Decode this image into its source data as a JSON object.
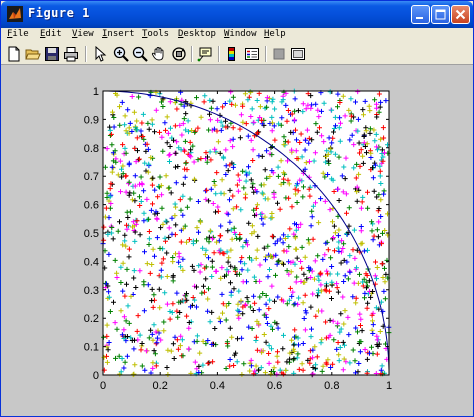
{
  "window": {
    "title": "Figure 1",
    "controls": [
      "minimize",
      "maximize",
      "close"
    ]
  },
  "menu": {
    "items": [
      {
        "label": "File",
        "key": "F"
      },
      {
        "label": "Edit",
        "key": "E"
      },
      {
        "label": "View",
        "key": "V"
      },
      {
        "label": "Insert",
        "key": "I"
      },
      {
        "label": "Tools",
        "key": "T"
      },
      {
        "label": "Desktop",
        "key": "D"
      },
      {
        "label": "Window",
        "key": "W"
      },
      {
        "label": "Help",
        "key": "H"
      }
    ]
  },
  "toolbar": {
    "icons": [
      "new-figure-icon",
      "open-file-icon",
      "save-figure-icon",
      "print-figure-icon",
      "edit-plot-arrow-icon",
      "zoom-in-icon",
      "zoom-out-icon",
      "pan-hand-icon",
      "rotate-3d-icon",
      "data-cursor-icon",
      "insert-colorbar-icon",
      "insert-legend-icon",
      "hide-plot-tools-icon",
      "show-plot-tools-icon"
    ]
  },
  "colors": {
    "figure_bg": "#c8c8c8",
    "axes_bg": "#ffffff",
    "curve": "#00008b",
    "marker_colors": [
      "#ff0000",
      "#008000",
      "#0000ff",
      "#00bfbf",
      "#ff00ff",
      "#bfbf00",
      "#000000"
    ]
  },
  "chart_data": {
    "type": "scatter",
    "title": "",
    "xlabel": "",
    "ylabel": "",
    "xlim": [
      0,
      1
    ],
    "ylim": [
      0,
      1
    ],
    "xticks": [
      "0",
      "0.2",
      "0.4",
      "0.6",
      "0.8",
      "1"
    ],
    "yticks": [
      "0",
      "0.1",
      "0.2",
      "0.3",
      "0.4",
      "0.5",
      "0.6",
      "0.7",
      "0.8",
      "0.9",
      "1"
    ],
    "grid": false,
    "legend": "none",
    "marker": "+",
    "series": [
      {
        "kind": "uniform-random-points",
        "count": 1500,
        "colors": "cycling red, green, blue, cyan, magenta, yellow, black"
      },
      {
        "kind": "curve",
        "equation": "x^2 + y^2 = 1",
        "x_range": [
          0,
          1
        ]
      }
    ]
  }
}
